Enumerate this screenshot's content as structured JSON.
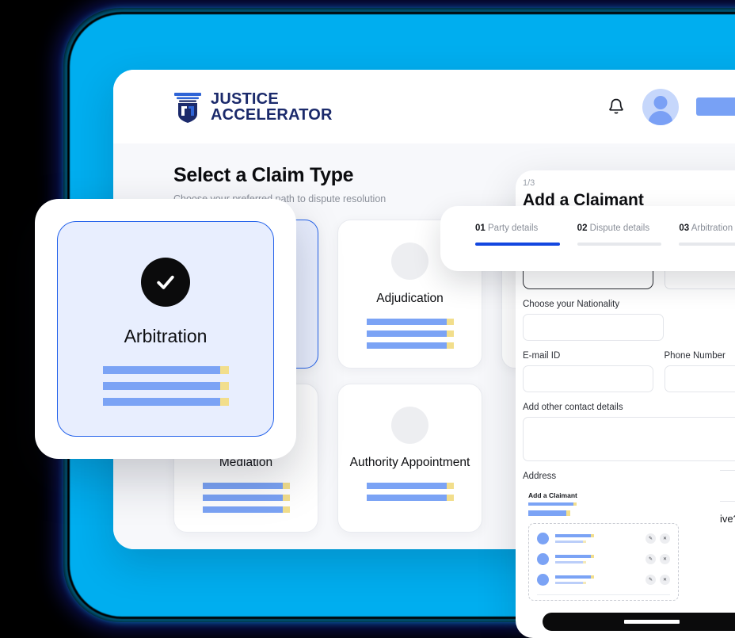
{
  "brand": {
    "logo_icon": "justice-pillar-icon",
    "name_line1": "JUSTICE",
    "name_line2": "ACCELERATOR",
    "navy": "#1B2A6B",
    "accent_cyan": "#00AEEF",
    "accent_blue": "#2563EB"
  },
  "header": {
    "bell_icon": "bell-icon",
    "avatar_icon": "user-avatar-icon",
    "action_pill": ""
  },
  "page": {
    "title": "Select a Claim Type",
    "subtitle": "Choose your preferred path to dispute resolution"
  },
  "claim_cards": [
    {
      "title": "",
      "lines": 3,
      "selected": true,
      "icon": "placeholder-circle-icon"
    },
    {
      "title": "Adjudication",
      "lines": 3,
      "selected": false,
      "icon": "placeholder-circle-icon"
    },
    {
      "title": "",
      "lines": 0,
      "selected": false,
      "icon": "placeholder-circle-icon"
    },
    {
      "title": "Mediation",
      "lines": 3,
      "selected": false,
      "icon": "placeholder-circle-icon"
    },
    {
      "title": "Authority Appointment",
      "lines": 2,
      "selected": false,
      "icon": "placeholder-circle-icon"
    }
  ],
  "floating_card": {
    "title": "Arbitration",
    "state_icon": "check-circle-icon",
    "selected": true,
    "lines": 3
  },
  "form_panel": {
    "step_counter": "1/3",
    "title": "Add a Claimant",
    "fields": [
      {
        "label": "",
        "type": "input-dark",
        "value": "",
        "placeholder": ""
      },
      {
        "label": "",
        "type": "input",
        "value": "",
        "placeholder": ""
      },
      {
        "label": "Choose your Nationality",
        "type": "input",
        "value": "",
        "placeholder": ""
      },
      {
        "label": "E-mail ID",
        "type": "input",
        "value": "",
        "placeholder": ""
      },
      {
        "label": "Phone Number",
        "type": "input",
        "value": "",
        "placeholder": ""
      },
      {
        "label": "Add other contact details",
        "type": "textarea",
        "value": "",
        "placeholder": ""
      },
      {
        "label": "Address",
        "type": "label-only",
        "value": "",
        "placeholder": ""
      }
    ],
    "right_question": "ive?",
    "mini_card": {
      "title": "Add a Claimant",
      "rows": 3,
      "row_actions": [
        "edit-icon",
        "delete-icon"
      ]
    },
    "cta_label": ""
  },
  "stepper": {
    "steps": [
      {
        "num": "01",
        "label": "Party details",
        "active": true
      },
      {
        "num": "02",
        "label": "Dispute details",
        "active": false
      },
      {
        "num": "03",
        "label": "Arbitration Det",
        "active": false
      }
    ]
  }
}
